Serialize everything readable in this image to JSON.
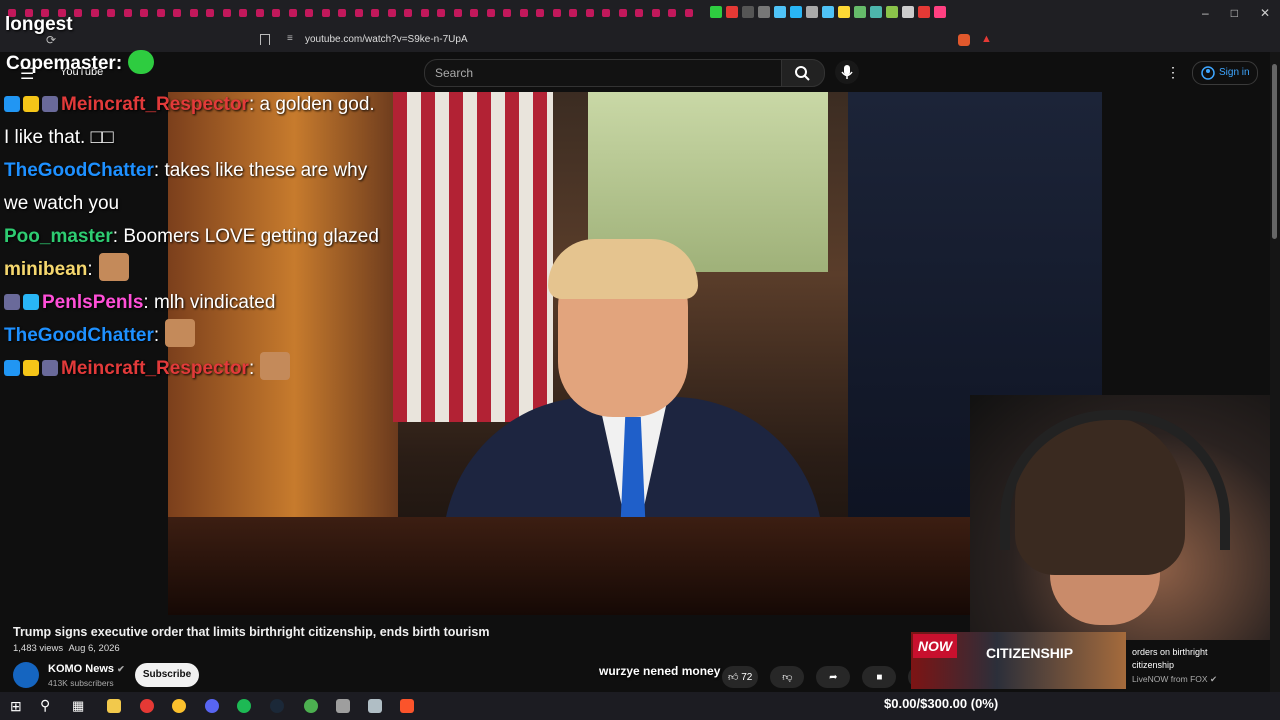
{
  "browser": {
    "url": "youtube.com/watch?v=S9ke-n-7UpA"
  },
  "youtube": {
    "logo_text": "YouTube",
    "search_placeholder": "Search",
    "sign_in_label": "Sign in"
  },
  "stream_overlay": {
    "title": "longest",
    "top_chatter": "Copemaster:",
    "bottom_text": "wurzye nened money",
    "donation_goal": "$0.00/$300.00 (0%)"
  },
  "chat": [
    {
      "user": "Meincraft_Respector",
      "color": "#e23a3a",
      "text": ": a golden god. I like that. □□",
      "badges": [
        "#2196f3",
        "#f5c518",
        "#6a6a9a"
      ]
    },
    {
      "user": "TheGoodChatter",
      "color": "#1e90ff",
      "text": ": takes like these are why we watch you",
      "badges": []
    },
    {
      "user": "Poo_master",
      "color": "#2ecc71",
      "text": ": Boomers LOVE getting glazed",
      "badges": []
    },
    {
      "user": "minibean",
      "color": "#f5d76e",
      "text": ":",
      "emote": true,
      "badges": []
    },
    {
      "user": "PenlsPenls",
      "color": "#ff4fd8",
      "text": ": mlh vindicated",
      "badges": [
        "#6a6a9a",
        "#29b6f6"
      ]
    },
    {
      "user": "TheGoodChatter",
      "color": "#1e90ff",
      "text": ":",
      "emote": true,
      "badges": []
    },
    {
      "user": "Meincraft_Respector",
      "color": "#e23a3a",
      "text": ":",
      "emote": true,
      "badges": [
        "#2196f3",
        "#f5c518",
        "#6a6a9a"
      ]
    }
  ],
  "video": {
    "title": "Trump signs executive order that limits birthright citizenship, ends birth tourism",
    "views": "1,483 views",
    "date": "Aug 6, 2026",
    "channel": "KOMO News",
    "subscribers": "413K subscribers",
    "subscribe_label": "Subscribe",
    "likes": "72"
  },
  "recommended": {
    "badge": "NOW",
    "headline": "CITIZENSHIP",
    "title": "orders on birthright citizenship",
    "channel": "LiveNOW from FOX"
  },
  "colors": {
    "youtube_bg": "#0f0f0f",
    "link_blue": "#3ea6ff",
    "now_red": "#c8102e"
  }
}
